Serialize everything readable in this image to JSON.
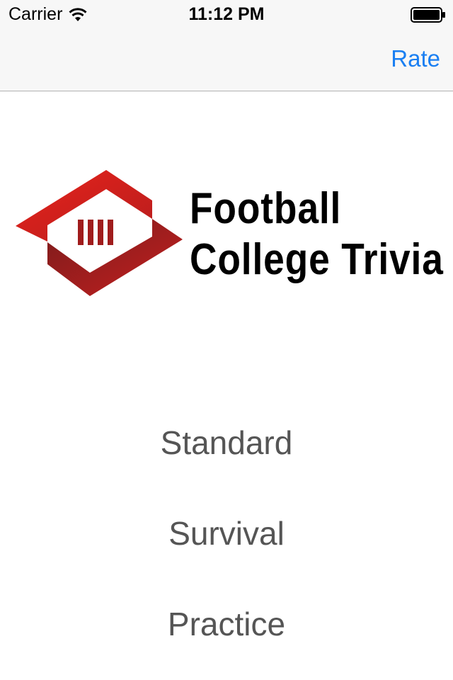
{
  "status_bar": {
    "carrier": "Carrier",
    "time": "11:12 PM",
    "icons": [
      "wifi-icon",
      "battery-icon"
    ]
  },
  "nav_bar": {
    "rate_label": "Rate",
    "accent_color": "#1a7ff2"
  },
  "logo": {
    "line1": "Football",
    "line2": "College Trivia",
    "colors": {
      "red": "#d9201b",
      "dark_red": "#7a1c1c",
      "text": "#000000"
    }
  },
  "modes": [
    {
      "label": "Standard"
    },
    {
      "label": "Survival"
    },
    {
      "label": "Practice"
    }
  ]
}
